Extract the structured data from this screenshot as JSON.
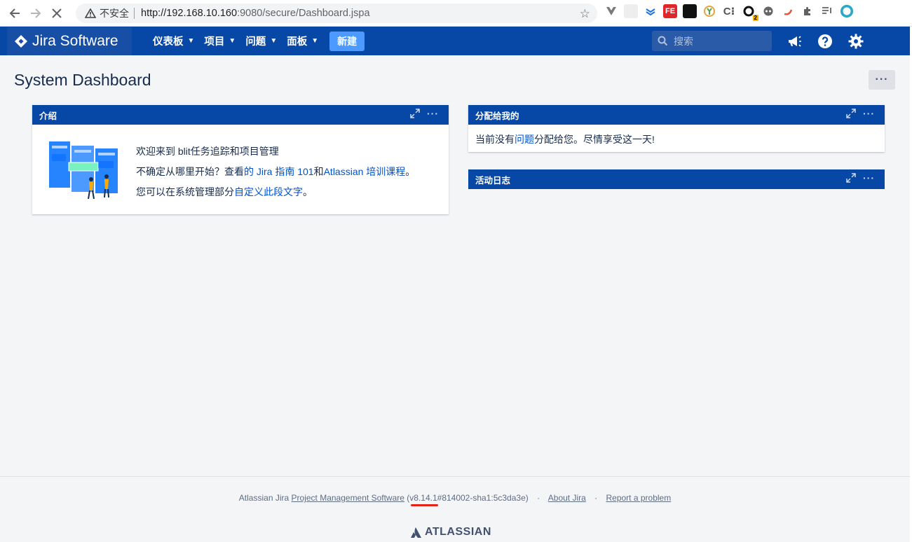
{
  "browser": {
    "insecure_label": "不安全",
    "url_host": "http://192.168.10.160",
    "url_path": ":9080/secure/Dashboard.jspa"
  },
  "header": {
    "logo_text": "Jira Software",
    "nav": [
      "仪表板",
      "项目",
      "问题",
      "面板"
    ],
    "create_label": "新建",
    "search_placeholder": "搜索"
  },
  "page": {
    "title": "System Dashboard"
  },
  "gadgets": {
    "intro": {
      "title": "介绍",
      "line1": "欢迎来到 blit任务追踪和项目管理",
      "line2_prefix": "不确定从哪里开始？查看",
      "line2_link1": "的 Jira 指南 101",
      "line2_mid": "和",
      "line2_link2": "Atlassian 培训课程",
      "line2_suffix": "。",
      "line3_prefix": "您可以在系统管理部分",
      "line3_link": "自定义此段文字",
      "line3_suffix": "。"
    },
    "assigned": {
      "title": "分配给我的",
      "text_prefix": "当前没有",
      "text_link": "问题",
      "text_suffix": "分配给您。尽情享受这一天!"
    },
    "activity": {
      "title": "活动日志"
    }
  },
  "footer": {
    "prefix": "Atlassian Jira",
    "pm_link": "Project Management Software",
    "version": "(v8.14.1#814002-sha1:5c3da3e)",
    "about": "About Jira",
    "report": "Report a problem",
    "brand": "ATLASSIAN"
  },
  "colors": {
    "header_bg": "#0747a6",
    "link": "#0052cc",
    "create_btn": "#4c9aff"
  }
}
